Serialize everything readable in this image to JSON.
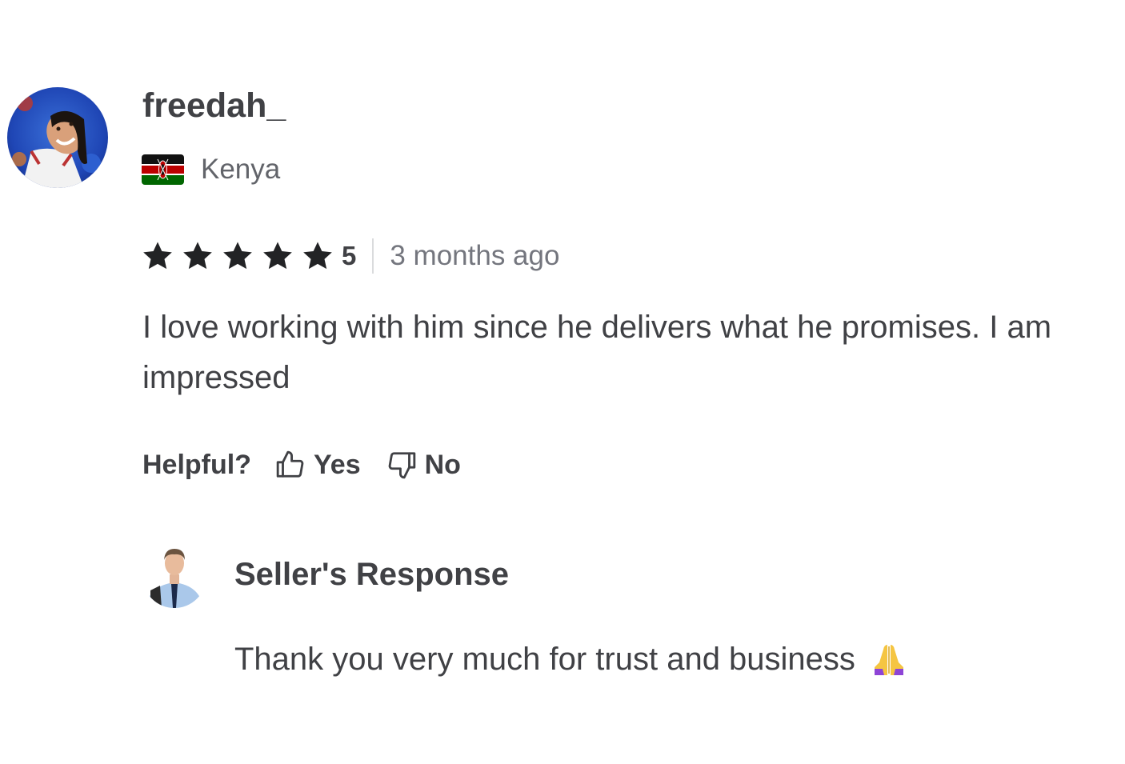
{
  "review": {
    "username": "freedah_",
    "country": "Kenya",
    "flag_icon": "kenya-flag-icon",
    "rating": "5",
    "stars_filled": 5,
    "stars_total": 5,
    "time_ago": "3 months ago",
    "text": "I love working with him since he delivers what he promises. I am impressed"
  },
  "helpful": {
    "label": "Helpful?",
    "yes_label": "Yes",
    "no_label": "No",
    "yes_icon": "thumbs-up-icon",
    "no_icon": "thumbs-down-icon"
  },
  "seller_response": {
    "title": "Seller's Response",
    "text": "Thank you very much for trust and business",
    "emoji_icon": "folded-hands-emoji-icon"
  },
  "colors": {
    "text_primary": "#404145",
    "text_secondary": "#62646a",
    "star": "#222325",
    "divider": "#dadbdd"
  }
}
